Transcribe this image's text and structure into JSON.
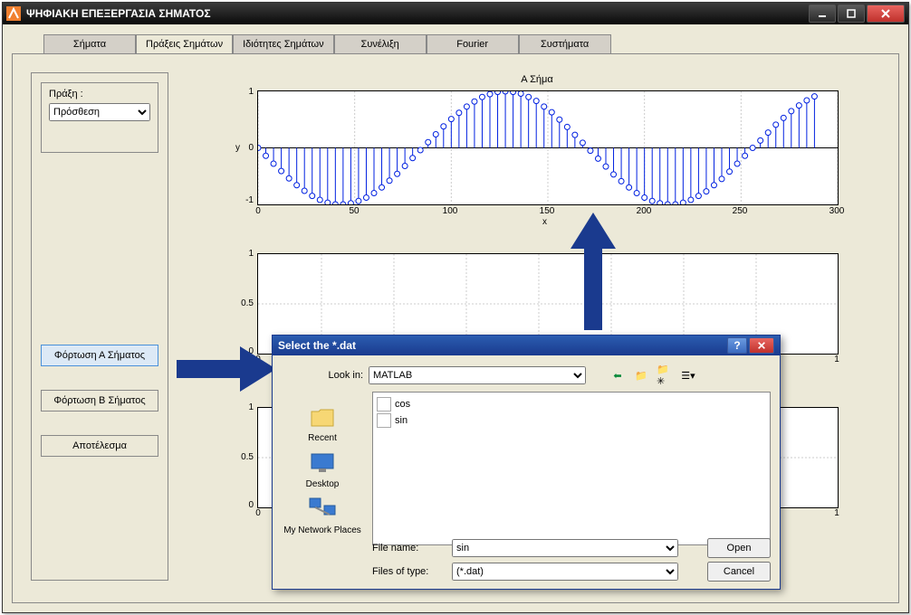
{
  "window": {
    "title": "ΨΗΦΙΑΚΗ ΕΠΕΞΕΡΓΑΣΙΑ ΣΗΜΑΤΟΣ"
  },
  "tabs": {
    "items": [
      "Σήματα",
      "Πράξεις Σημάτων",
      "Ιδιότητες Σημάτων",
      "Συνέλιξη",
      "Fourier",
      "Συστήματα"
    ],
    "active": 1
  },
  "sidebar": {
    "praxi_label": "Πράξη :",
    "praxi_value": "Πρόσθεση",
    "btn_load_a": "Φόρτωση Α Σήματος",
    "btn_load_b": "Φόρτωση Β Σήματος",
    "btn_result": "Αποτέλεσμα"
  },
  "chart_data": [
    {
      "type": "stem",
      "title": "Α Σήμα",
      "xlabel": "x",
      "ylabel": "y",
      "xlim": [
        0,
        300
      ],
      "ylim": [
        -1,
        1
      ],
      "xticks": [
        0,
        50,
        100,
        150,
        200,
        250,
        300
      ],
      "yticks": [
        -1,
        0,
        1
      ],
      "x": [
        0,
        4,
        8,
        12,
        16,
        20,
        24,
        28,
        32,
        36,
        40,
        44,
        48,
        52,
        56,
        60,
        64,
        68,
        72,
        76,
        80,
        84,
        88,
        92,
        96,
        100,
        104,
        108,
        112,
        116,
        120,
        124,
        128,
        132,
        136,
        140,
        144,
        148,
        152,
        156,
        160,
        164,
        168,
        172,
        176,
        180,
        184,
        188,
        192,
        196,
        200,
        204,
        208,
        212,
        216,
        220,
        224,
        228,
        232,
        236,
        240,
        244,
        248,
        252,
        256,
        260,
        264,
        268,
        272,
        276,
        280,
        284,
        288
      ],
      "y": [
        0.0,
        -0.14,
        -0.28,
        -0.41,
        -0.54,
        -0.66,
        -0.76,
        -0.85,
        -0.92,
        -0.97,
        -1.0,
        -1.0,
        -0.98,
        -0.94,
        -0.88,
        -0.8,
        -0.7,
        -0.58,
        -0.46,
        -0.32,
        -0.18,
        -0.04,
        0.1,
        0.24,
        0.38,
        0.51,
        0.62,
        0.73,
        0.82,
        0.9,
        0.95,
        0.99,
        1.0,
        0.99,
        0.96,
        0.9,
        0.83,
        0.73,
        0.63,
        0.5,
        0.37,
        0.23,
        0.09,
        -0.05,
        -0.19,
        -0.33,
        -0.47,
        -0.59,
        -0.7,
        -0.8,
        -0.88,
        -0.94,
        -0.98,
        -1.0,
        -1.0,
        -0.97,
        -0.92,
        -0.85,
        -0.77,
        -0.66,
        -0.55,
        -0.42,
        -0.28,
        -0.14,
        0.0,
        0.13,
        0.27,
        0.41,
        0.53,
        0.65,
        0.75,
        0.84,
        0.91
      ]
    },
    {
      "type": "stem",
      "title": "",
      "xlabel": "",
      "ylabel": "",
      "xlim": [
        0,
        1
      ],
      "ylim": [
        0,
        1
      ],
      "xticks": [
        0,
        1
      ],
      "yticks": [
        0,
        0.5,
        1
      ],
      "x": [],
      "y": []
    },
    {
      "type": "stem",
      "title": "",
      "xlabel": "",
      "ylabel": "",
      "xlim": [
        0,
        1
      ],
      "ylim": [
        0,
        1
      ],
      "xticks": [
        0,
        1
      ],
      "yticks": [
        0,
        0.5,
        1
      ],
      "x": [],
      "y": []
    }
  ],
  "dialog": {
    "title": "Select the *.dat",
    "look_in_label": "Look in:",
    "look_in_value": "MATLAB",
    "places": {
      "recent": "Recent",
      "desktop": "Desktop",
      "network": "My Network Places"
    },
    "files": [
      "cos",
      "sin"
    ],
    "filename_label": "File name:",
    "filename_value": "sin",
    "filetype_label": "Files of type:",
    "filetype_value": "(*.dat)",
    "open": "Open",
    "cancel": "Cancel"
  }
}
